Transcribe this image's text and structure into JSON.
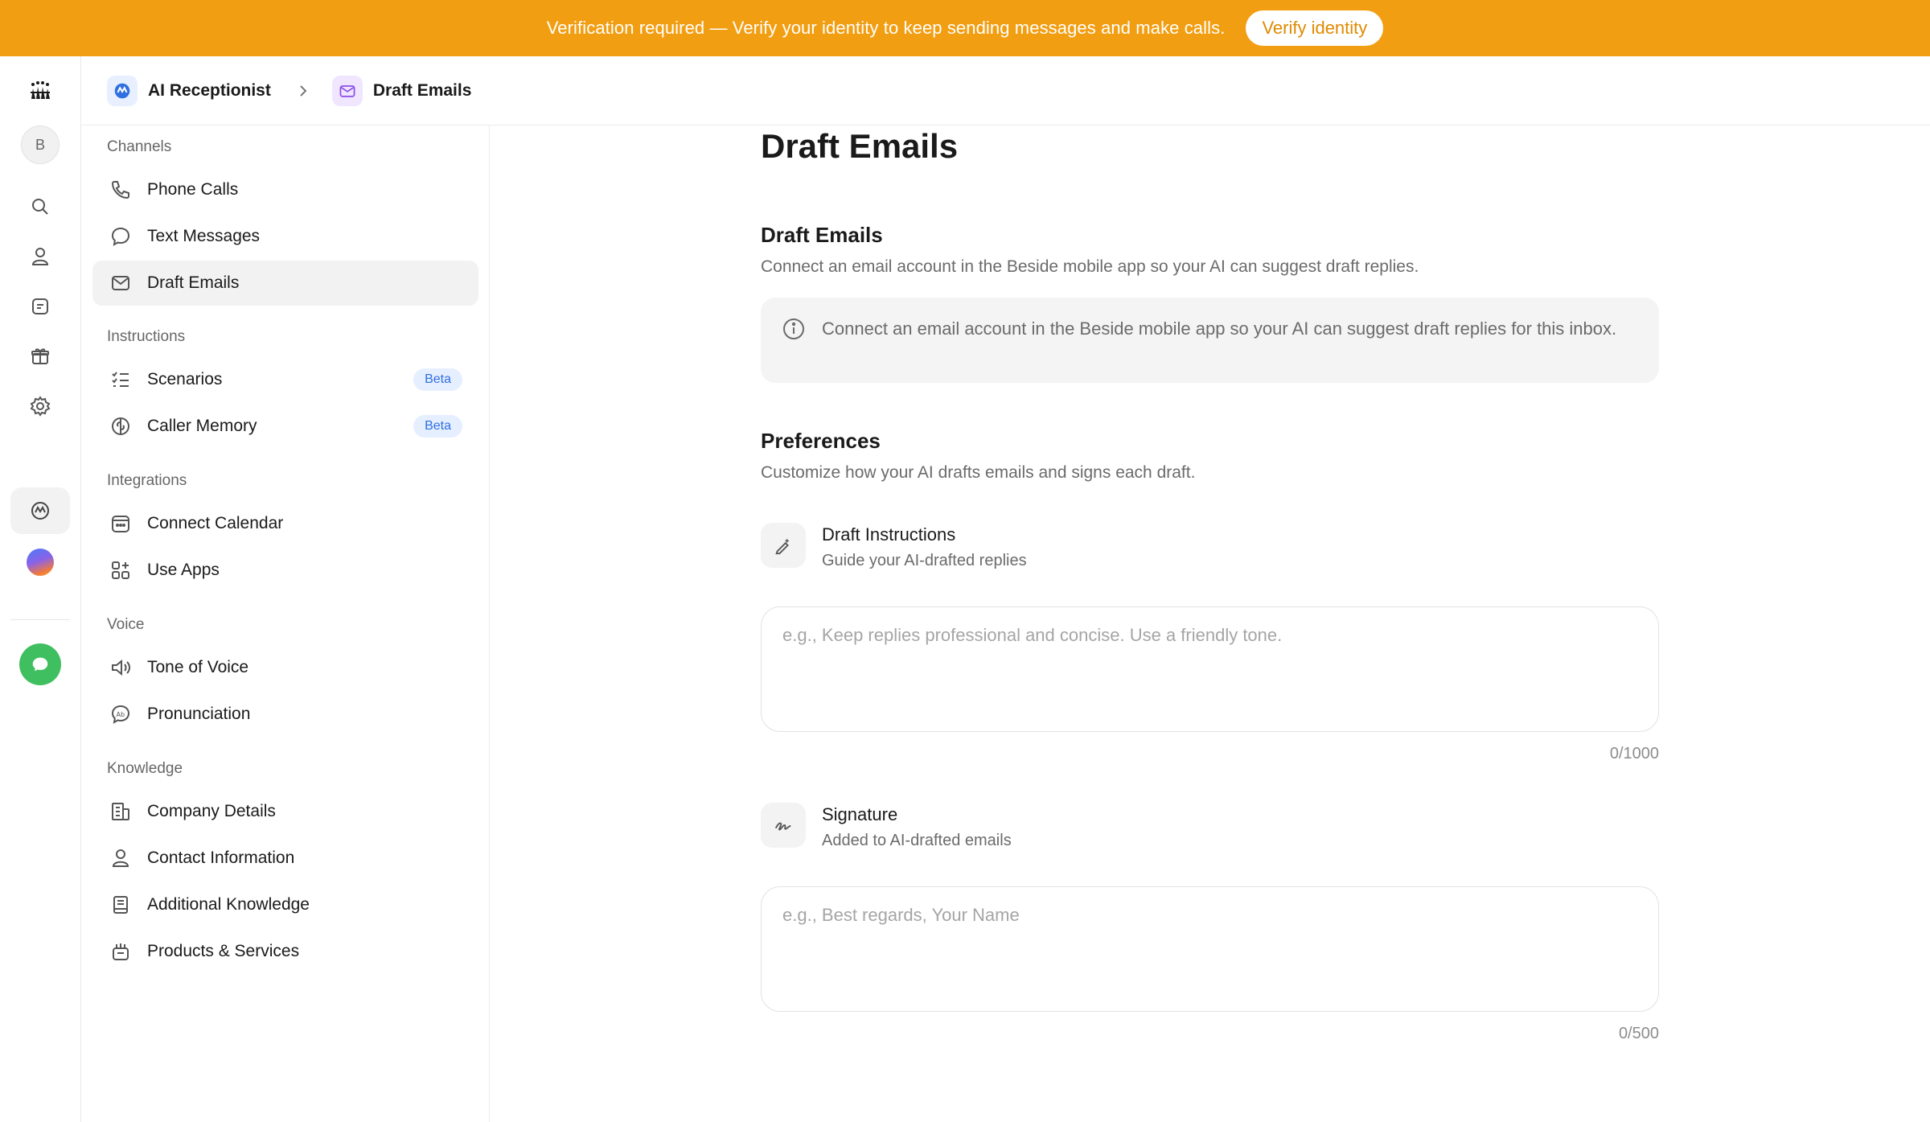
{
  "banner": {
    "text": "Verification required — Verify your identity to keep sending messages and make calls.",
    "button_label": "Verify identity",
    "color": "#f29e12"
  },
  "rail": {
    "avatar_initial": "B",
    "icons": [
      "app-logo-icon",
      "search-icon",
      "contacts-icon",
      "notes-icon",
      "gift-icon",
      "settings-icon",
      "ai-receptionist-icon",
      "gradient-orb-icon",
      "chat-icon"
    ]
  },
  "breadcrumb": {
    "items": [
      {
        "label": "AI Receptionist",
        "icon": "ai-receptionist-icon"
      },
      {
        "label": "Draft Emails",
        "icon": "mail-icon"
      }
    ]
  },
  "nav": {
    "sections": [
      {
        "title": "Channels",
        "items": [
          {
            "label": "Phone Calls",
            "icon": "phone-icon"
          },
          {
            "label": "Text Messages",
            "icon": "message-bubble-icon"
          },
          {
            "label": "Draft Emails",
            "icon": "mail-icon",
            "active": true
          }
        ]
      },
      {
        "title": "Instructions",
        "items": [
          {
            "label": "Scenarios",
            "icon": "checklist-icon",
            "badge": "Beta"
          },
          {
            "label": "Caller Memory",
            "icon": "brain-icon",
            "badge": "Beta"
          }
        ]
      },
      {
        "title": "Integrations",
        "items": [
          {
            "label": "Connect Calendar",
            "icon": "calendar-icon"
          },
          {
            "label": "Use Apps",
            "icon": "apps-grid-icon"
          }
        ]
      },
      {
        "title": "Voice",
        "items": [
          {
            "label": "Tone of Voice",
            "icon": "speaker-icon"
          },
          {
            "label": "Pronunciation",
            "icon": "pronunciation-icon"
          }
        ]
      },
      {
        "title": "Knowledge",
        "items": [
          {
            "label": "Company Details",
            "icon": "building-icon"
          },
          {
            "label": "Contact Information",
            "icon": "person-icon"
          },
          {
            "label": "Additional Knowledge",
            "icon": "book-icon"
          },
          {
            "label": "Products & Services",
            "icon": "products-icon"
          }
        ]
      }
    ]
  },
  "main": {
    "page_title": "Draft Emails",
    "draft_section": {
      "title": "Draft Emails",
      "description": "Connect an email account in the Beside mobile app so your AI can suggest draft replies.",
      "info_text": "Connect an email account in the Beside mobile app so your AI can suggest draft replies for this inbox."
    },
    "preferences": {
      "title": "Preferences",
      "description": "Customize how your AI drafts emails and signs each draft.",
      "instructions": {
        "title": "Draft Instructions",
        "subtitle": "Guide your AI-drafted replies",
        "placeholder": "e.g., Keep replies professional and concise. Use a friendly tone.",
        "value": "",
        "counter": "0/1000"
      },
      "signature": {
        "title": "Signature",
        "subtitle": "Added to AI-drafted emails",
        "placeholder": "e.g., Best regards, Your Name",
        "value": "",
        "counter": "0/500"
      }
    }
  }
}
